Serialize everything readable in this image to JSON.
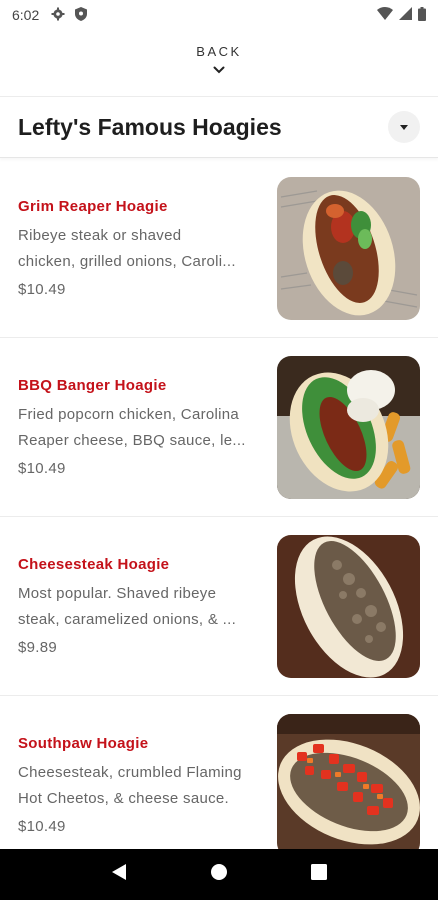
{
  "status_bar": {
    "time": "6:02",
    "left_icons": [
      "gear-icon",
      "shield-icon"
    ],
    "right_icons": [
      "wifi-icon",
      "signal-icon",
      "battery-icon"
    ]
  },
  "back": {
    "label": "BACK",
    "icon": "chevron-down-icon"
  },
  "header": {
    "title": "Lefty's Famous Hoagies",
    "dropdown_icon": "caret-down-icon"
  },
  "accent_color": "#c4121a",
  "items": [
    {
      "name": "Grim Reaper Hoagie",
      "description_line1": "Ribeye steak or shaved",
      "description_line2": "chicken, grilled onions, Caroli...",
      "price": "$10.49"
    },
    {
      "name": "BBQ Banger Hoagie",
      "description_line1": "Fried popcorn chicken, Carolina",
      "description_line2": "Reaper cheese, BBQ sauce, le...",
      "price": "$10.49"
    },
    {
      "name": "Cheesesteak Hoagie",
      "description_line1": "Most popular. Shaved ribeye",
      "description_line2": "steak, caramelized onions, & ...",
      "price": "$9.89"
    },
    {
      "name": "Southpaw Hoagie",
      "description_line1": "Cheesesteak, crumbled Flaming",
      "description_line2": "Hot Cheetos, & cheese sauce.",
      "price": "$10.49"
    }
  ],
  "nav_bar": {
    "icons": [
      "back-triangle-icon",
      "home-circle-icon",
      "recents-square-icon"
    ]
  }
}
